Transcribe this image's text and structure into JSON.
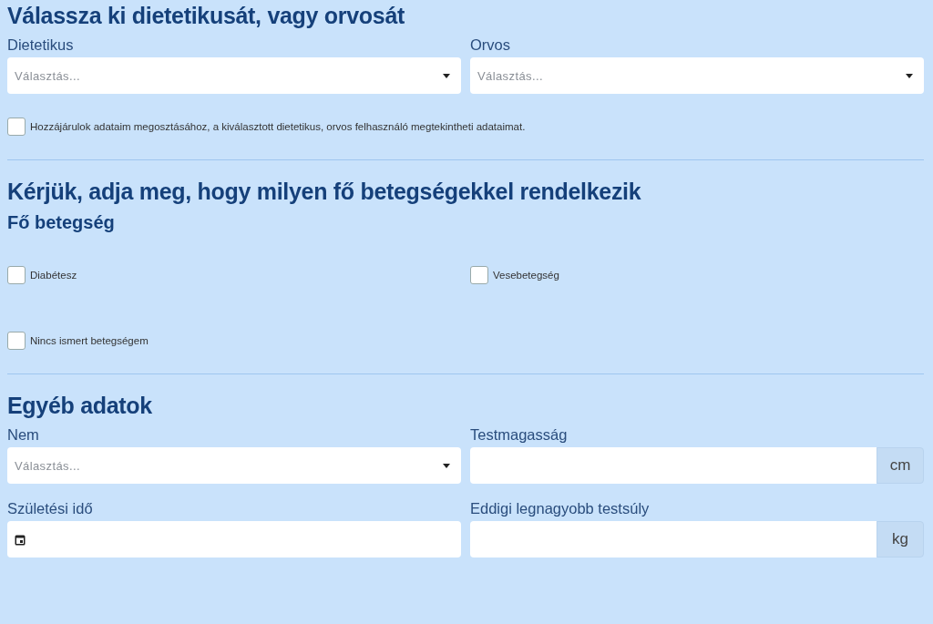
{
  "doctor_section": {
    "title": "Válassza ki dietetikusát, vagy orvosát",
    "fields": [
      {
        "label": "Dietetikus",
        "kind": "select",
        "placeholder": "Választás..."
      },
      {
        "label": "Orvos",
        "kind": "select",
        "placeholder": "Választás..."
      }
    ],
    "consent": {
      "label": "Hozzájárulok adataim megosztásához, a kiválasztott dietetikus, orvos felhasználó megtekintheti adataimat.",
      "checked": false
    }
  },
  "disease_section": {
    "title": "Kérjük, adja meg, hogy milyen fő betegségekkel rendelkezik",
    "subtitle": "Fő betegség",
    "options": [
      {
        "label": "Diabétesz",
        "checked": false
      },
      {
        "label": "Vesebetegség",
        "checked": false
      },
      {
        "label": "Nincs ismert betegségem",
        "checked": false
      }
    ]
  },
  "other_section": {
    "title": "Egyéb adatok",
    "fields": [
      {
        "label": "Nem",
        "kind": "select",
        "placeholder": "Választás..."
      },
      {
        "label": "Testmagasság",
        "kind": "unit",
        "unit": "cm"
      },
      {
        "label": "Születési idő",
        "kind": "date"
      },
      {
        "label": "Eddigi legnagyobb testsúly",
        "kind": "unit",
        "unit": "kg"
      }
    ]
  }
}
